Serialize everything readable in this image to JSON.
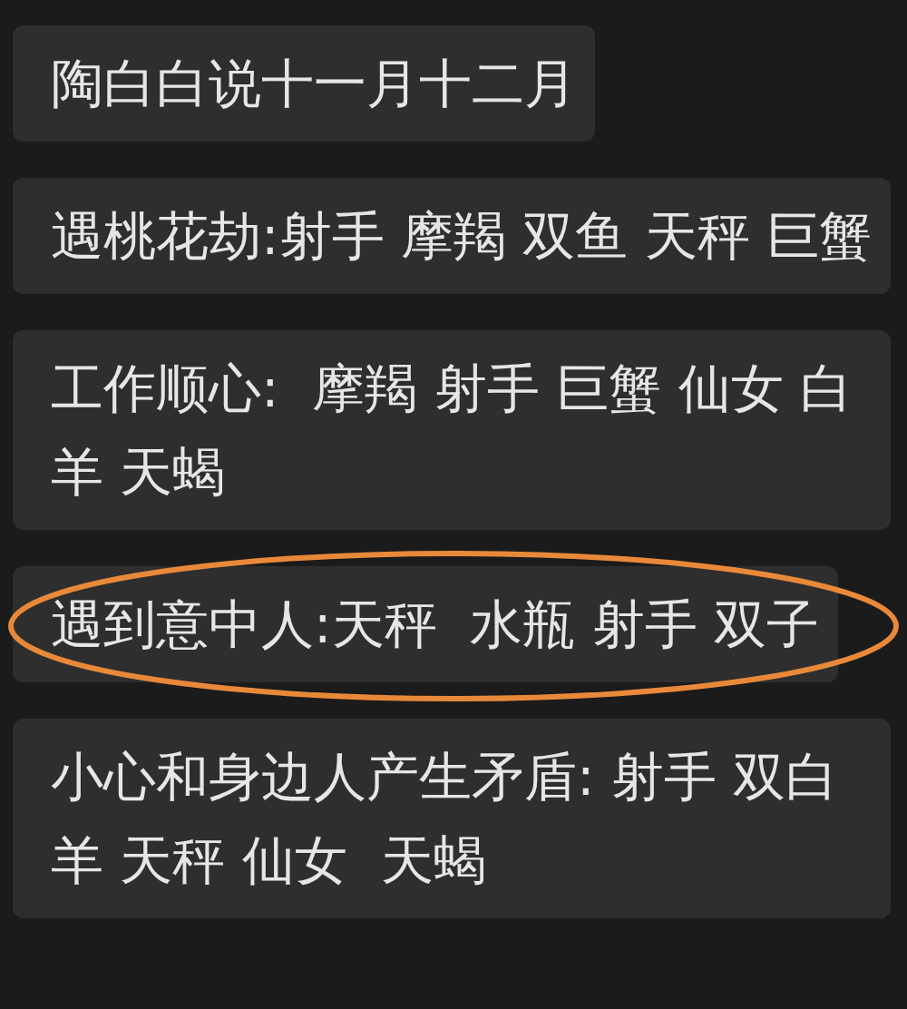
{
  "messages": [
    {
      "text": "陶白白说十一月十二月"
    },
    {
      "text": "遇桃花劫:射手 摩羯 双鱼 天秤 巨蟹"
    },
    {
      "text": "工作顺心:  摩羯 射手 巨蟹 仙女 白羊 天蝎"
    },
    {
      "text": "遇到意中人:天秤  水瓶 射手 双子",
      "circled": true
    },
    {
      "text": "小心和身边人产生矛盾: 射手 双白羊 天秤 仙女  天蝎"
    }
  ]
}
